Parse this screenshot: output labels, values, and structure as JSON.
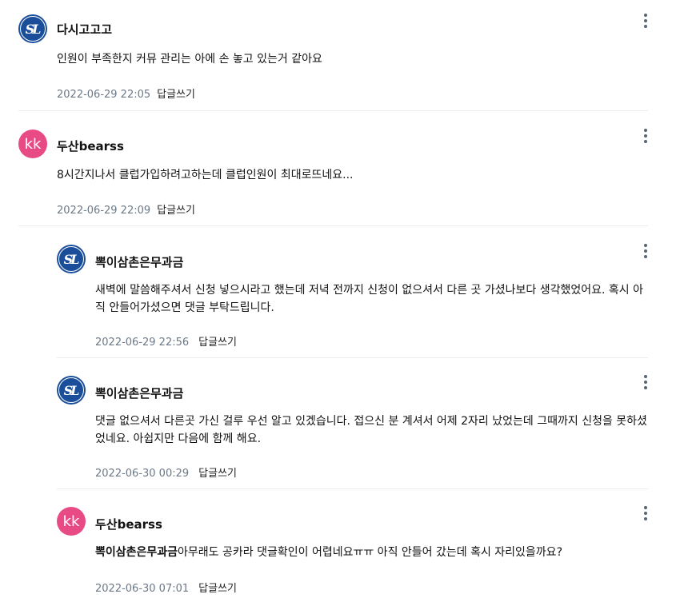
{
  "comments": [
    {
      "nickname": "다시고고고",
      "avatar_type": "logo",
      "avatar_text": "SL",
      "mention": "",
      "text": "인원이 부족한지 커뮤 관리는 아에 손 놓고 있는거 같아요",
      "date": "2022-06-29 22:05",
      "reply_label": "답글쓰기"
    },
    {
      "nickname": "두산bearss",
      "avatar_type": "letters",
      "avatar_text": "kk",
      "mention": "",
      "text": "8시간지나서 클럽가입하려고하는데 클럽인원이 최대로뜨네요...",
      "date": "2022-06-29 22:09",
      "reply_label": "답글쓰기"
    },
    {
      "nickname": "뽁이삼촌은무과금",
      "avatar_type": "logo",
      "avatar_text": "SL",
      "mention": "",
      "text": "새벽에 말씀해주셔서 신청 넣으시라고 했는데 저녁 전까지 신청이 없으셔서 다른 곳 가셨나보다 생각했었어요. 혹시 아직 안들어가셨으면 댓글 부탁드립니다.",
      "date": "2022-06-29 22:56",
      "reply_label": "답글쓰기"
    },
    {
      "nickname": "뽁이삼촌은무과금",
      "avatar_type": "logo",
      "avatar_text": "SL",
      "mention": "",
      "text": "댓글 없으셔서 다른곳 가신 걸루 우선 알고 있겠습니다. 접으신 분 계셔서 어제 2자리 났었는데 그때까지 신청을 못하셨었네요. 아쉽지만 다음에 함께 해요.",
      "date": "2022-06-30 00:29",
      "reply_label": "답글쓰기"
    },
    {
      "nickname": "두산bearss",
      "avatar_type": "letters",
      "avatar_text": "kk",
      "mention": "뽁이삼촌은무과금",
      "text": "아무래도 공카라 댓글확인이 어렵네요ㅠㅠ 아직 안들어 갔는데 혹시 자리있을까요?",
      "date": "2022-06-30 07:01",
      "reply_label": "답글쓰기"
    }
  ],
  "colors": {
    "logo_avatar_bg": "#1a4e9a",
    "letters_avatar_bg": "#e84a86",
    "date_text": "#6b7886",
    "divider": "#ececec"
  }
}
